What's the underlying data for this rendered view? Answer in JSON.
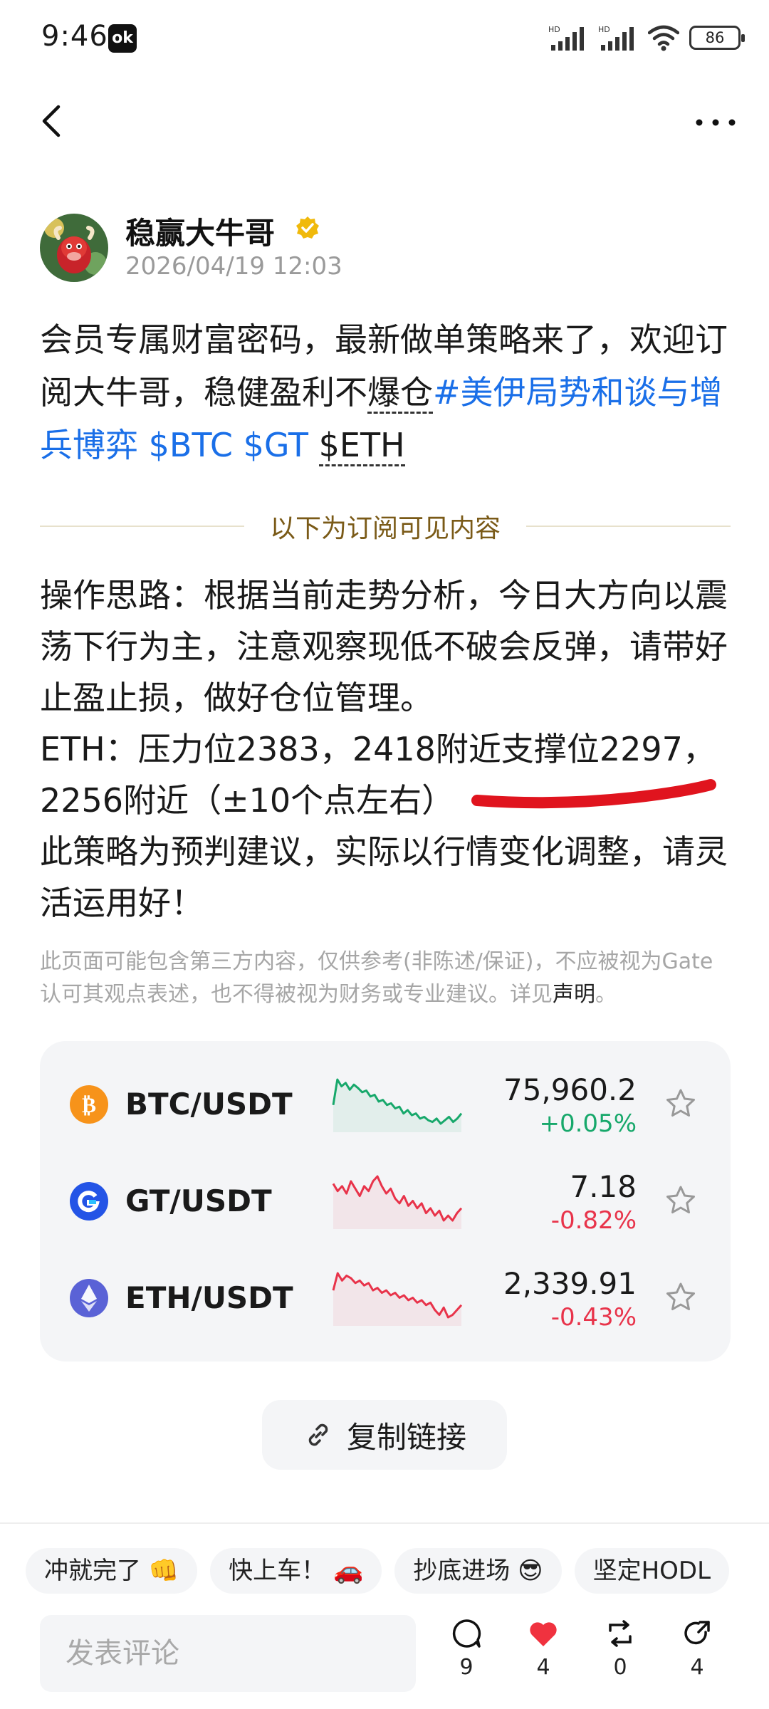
{
  "status_bar": {
    "time": "9:46",
    "app_icon_text": "ok",
    "battery": "86"
  },
  "author": {
    "name": "稳赢大牛哥",
    "time": "2026/04/19 12:03"
  },
  "post": {
    "text_plain": "会员专属财富密码，最新做单策略来了，欢迎订阅大牛哥，稳健盈利不",
    "text_dashed_1": "爆仓",
    "hashtag": "#美伊局势和谈与增兵博弈",
    "ticker_btc": "$BTC",
    "ticker_gt": "$GT",
    "ticker_eth": "$ETH"
  },
  "paywall_divider": "以下为订阅可见内容",
  "strategy": {
    "line1": "操作思路：根据当前走势分析，今日大方向以震荡下行为主，注意观察现低不破会反弹，请带好止盈止损，做好仓位管理。",
    "line2": "ETH：压力位2383，2418附近支撑位2297，2256附近（±10个点左右）",
    "line3": "此策略为预判建议，实际以行情变化调整，请灵活运用好！"
  },
  "disclaimer": {
    "text": "此页面可能包含第三方内容，仅供参考(非陈述/保证)，不应被视为Gate认可其观点表述，也不得被视为财务或专业建议。详见",
    "link": "声明",
    "end": "。"
  },
  "markets": [
    {
      "pair": "BTC/USDT",
      "price": "75,960.2",
      "change": "+0.05%",
      "trend": "up",
      "icon": "bitcoin-icon",
      "color": "#17a86b",
      "series": [
        40,
        70,
        62,
        66,
        58,
        64,
        60,
        55,
        57,
        50,
        52,
        44,
        46,
        40,
        42,
        36,
        38,
        30,
        34,
        28,
        30,
        24,
        26,
        22,
        20,
        24,
        18,
        22,
        26,
        20,
        24,
        30
      ]
    },
    {
      "pair": "GT/USDT",
      "price": "7.18",
      "change": "-0.82%",
      "trend": "down",
      "icon": "gt-icon",
      "color": "#e8334a",
      "series": [
        60,
        54,
        58,
        52,
        62,
        56,
        50,
        58,
        54,
        62,
        66,
        58,
        52,
        56,
        48,
        44,
        50,
        42,
        46,
        40,
        44,
        36,
        40,
        34,
        38,
        30,
        34,
        30,
        36,
        40
      ]
    },
    {
      "pair": "ETH/USDT",
      "price": "2,339.91",
      "change": "-0.43%",
      "trend": "down",
      "icon": "ethereum-icon",
      "color": "#e8334a",
      "series": [
        50,
        64,
        58,
        62,
        60,
        56,
        58,
        54,
        56,
        50,
        52,
        48,
        50,
        46,
        48,
        44,
        46,
        42,
        44,
        40,
        42,
        38,
        40,
        34,
        30,
        36,
        28,
        30,
        34,
        38
      ]
    }
  ],
  "copy_link_label": "复制链接",
  "quick_replies": [
    "冲就完了 👊",
    "快上车！ 🚗",
    "抄底进场 😎",
    "坚定HODL"
  ],
  "comment_placeholder": "发表评论",
  "actions": {
    "comments": "9",
    "likes": "4",
    "reposts": "0",
    "shares": "4"
  },
  "colors": {
    "link_blue": "#1a6fe8",
    "up_green": "#17a86b",
    "down_red": "#e8334a",
    "gold": "#7a5a17"
  }
}
